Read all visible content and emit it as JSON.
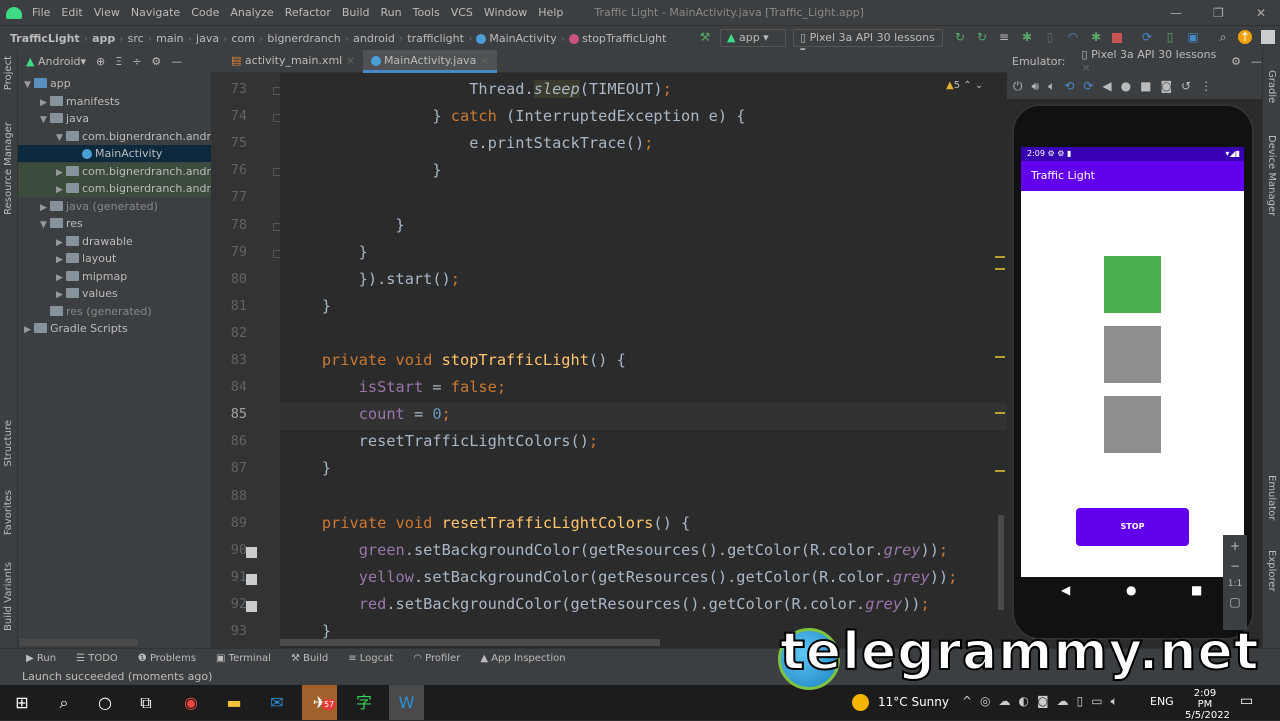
{
  "menu": {
    "items": [
      "File",
      "Edit",
      "View",
      "Navigate",
      "Code",
      "Analyze",
      "Refactor",
      "Build",
      "Run",
      "Tools",
      "VCS",
      "Window",
      "Help"
    ],
    "title": "Traffic Light - MainActivity.java [Traffic_Light.app]"
  },
  "breadcrumb": [
    "TrafficLight",
    "app",
    "src",
    "main",
    "java",
    "com",
    "bignerdranch",
    "android",
    "trafficlight",
    "MainActivity",
    "stopTrafficLight"
  ],
  "toolbar": {
    "run_config": "app",
    "device": "Pixel 3a API 30 lessons"
  },
  "left_strip": [
    "Project",
    "Resource Manager",
    "Structure",
    "Favorites",
    "Build Variants"
  ],
  "right_strip": [
    "Gradle",
    "Device Manager",
    "Emulator",
    "Device File Explorer"
  ],
  "project": {
    "view": "Android",
    "tree": [
      {
        "label": "app",
        "depth": 0,
        "open": true,
        "gen": false
      },
      {
        "label": "manifests",
        "depth": 1,
        "open": false,
        "gen": false
      },
      {
        "label": "java",
        "depth": 1,
        "open": true,
        "gen": false
      },
      {
        "label": "com.bignerdranch.android",
        "depth": 2,
        "open": true,
        "gen": false
      },
      {
        "label": "MainActivity",
        "depth": 3,
        "open": null,
        "gen": false,
        "selected": true
      },
      {
        "label": "com.bignerdranch.android",
        "depth": 2,
        "open": false,
        "gen": false
      },
      {
        "label": "com.bignerdranch.android",
        "depth": 2,
        "open": false,
        "gen": false
      },
      {
        "label": "java (generated)",
        "depth": 1,
        "open": false,
        "gen": true
      },
      {
        "label": "res",
        "depth": 1,
        "open": true,
        "gen": false
      },
      {
        "label": "drawable",
        "depth": 2,
        "open": false,
        "gen": false
      },
      {
        "label": "layout",
        "depth": 2,
        "open": false,
        "gen": false
      },
      {
        "label": "mipmap",
        "depth": 2,
        "open": false,
        "gen": false
      },
      {
        "label": "values",
        "depth": 2,
        "open": false,
        "gen": false
      },
      {
        "label": "res (generated)",
        "depth": 1,
        "open": null,
        "gen": true
      },
      {
        "label": "Gradle Scripts",
        "depth": 0,
        "open": false,
        "gen": false
      }
    ]
  },
  "tabs": [
    {
      "label": "activity_main.xml",
      "active": false
    },
    {
      "label": "MainActivity.java",
      "active": true
    }
  ],
  "editor": {
    "warnings": "5",
    "current_line": 85,
    "lines": [
      {
        "n": 73,
        "t": [
          [
            "                    Thread.",
            ""
          ],
          [
            "sleep",
            "st"
          ],
          [
            "(TIMEOUT)",
            ""
          ],
          [
            ";",
            "kw"
          ]
        ]
      },
      {
        "n": 74,
        "t": [
          [
            "                } ",
            ""
          ],
          [
            "catch",
            "kw"
          ],
          [
            " (InterruptedException e) {",
            ""
          ]
        ]
      },
      {
        "n": 75,
        "t": [
          [
            "                    e.printStackTrace()",
            ""
          ],
          [
            ";",
            "kw"
          ]
        ]
      },
      {
        "n": 76,
        "t": [
          [
            "                }",
            ""
          ]
        ]
      },
      {
        "n": 77,
        "t": []
      },
      {
        "n": 78,
        "t": [
          [
            "            }",
            ""
          ]
        ]
      },
      {
        "n": 79,
        "t": [
          [
            "        }",
            ""
          ]
        ]
      },
      {
        "n": 80,
        "t": [
          [
            "        }).start()",
            ""
          ],
          [
            ";",
            "kw"
          ]
        ]
      },
      {
        "n": 81,
        "t": [
          [
            "    }",
            ""
          ]
        ]
      },
      {
        "n": 82,
        "t": []
      },
      {
        "n": 83,
        "t": [
          [
            "    ",
            ""
          ],
          [
            "private void ",
            "kw"
          ],
          [
            "stopTrafficLight",
            "fn"
          ],
          [
            "() {",
            ""
          ]
        ]
      },
      {
        "n": 84,
        "t": [
          [
            "        ",
            ""
          ],
          [
            "isStart",
            "fld"
          ],
          [
            " = ",
            ""
          ],
          [
            "false",
            "kw"
          ],
          [
            ";",
            "kw"
          ]
        ]
      },
      {
        "n": 85,
        "t": [
          [
            "        ",
            ""
          ],
          [
            "count",
            "fld"
          ],
          [
            " = ",
            ""
          ],
          [
            "0",
            "num"
          ],
          [
            ";",
            "kw"
          ]
        ]
      },
      {
        "n": 86,
        "t": [
          [
            "        resetTrafficLightColors()",
            ""
          ],
          [
            ";",
            "kw"
          ]
        ]
      },
      {
        "n": 87,
        "t": [
          [
            "    }",
            ""
          ]
        ]
      },
      {
        "n": 88,
        "t": []
      },
      {
        "n": 89,
        "t": [
          [
            "    ",
            ""
          ],
          [
            "private void ",
            "kw"
          ],
          [
            "resetTrafficLightColors",
            "fn"
          ],
          [
            "() {",
            ""
          ]
        ]
      },
      {
        "n": 90,
        "t": [
          [
            "        ",
            ""
          ],
          [
            "green",
            "fld"
          ],
          [
            ".setBackgroundColor(getResources().getColor(R.color.",
            ""
          ],
          [
            "grey",
            "it"
          ],
          [
            "))",
            ""
          ],
          [
            ";",
            "kw"
          ]
        ]
      },
      {
        "n": 91,
        "t": [
          [
            "        ",
            ""
          ],
          [
            "yellow",
            "fld"
          ],
          [
            ".setBackgroundColor(getResources().getColor(R.color.",
            ""
          ],
          [
            "grey",
            "it"
          ],
          [
            "))",
            ""
          ],
          [
            ";",
            "kw"
          ]
        ]
      },
      {
        "n": 92,
        "t": [
          [
            "        ",
            ""
          ],
          [
            "red",
            "fld"
          ],
          [
            ".setBackgroundColor(getResources().getColor(R.color.",
            ""
          ],
          [
            "grey",
            "it"
          ],
          [
            "))",
            ""
          ],
          [
            ";",
            "kw"
          ]
        ]
      },
      {
        "n": 93,
        "t": [
          [
            "    }",
            ""
          ]
        ]
      }
    ]
  },
  "emulator": {
    "label": "Emulator:",
    "device_tab": "Pixel 3a API 30 lessons",
    "time": "2:09",
    "app_title": "Traffic Light",
    "lights": [
      "#4caf50",
      "#8e8e8e",
      "#8e8e8e"
    ],
    "button": "STOP",
    "zoom_reset": "1:1"
  },
  "bottom_tools": [
    "Run",
    "TODO",
    "Problems",
    "Terminal",
    "Build",
    "Logcat",
    "Profiler",
    "App Inspection"
  ],
  "status": "Launch succeeded (moments ago)",
  "taskbar": {
    "weather": "11°C  Sunny",
    "lang": "ENG",
    "time": "2:09 PM",
    "date": "5/5/2022",
    "telegram_badge": "57"
  },
  "watermark": "telegrammy.net"
}
